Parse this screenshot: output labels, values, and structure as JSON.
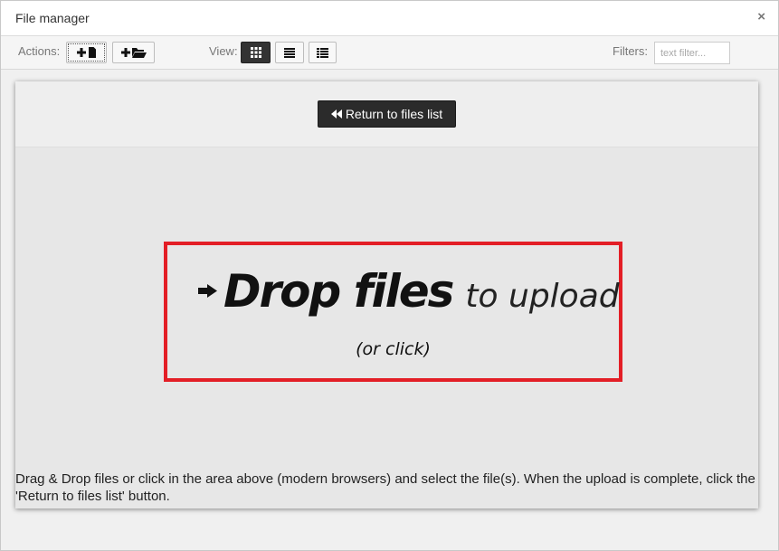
{
  "window": {
    "title": "File manager",
    "close_symbol": "×"
  },
  "toolbar": {
    "actions_label": "Actions:",
    "view_label": "View:",
    "filters_label": "Filters:",
    "filter_placeholder": "text filter...",
    "buttons": [
      {
        "name": "add-file-button",
        "icon": "plus-file-icon"
      },
      {
        "name": "add-folder-button",
        "icon": "plus-folder-icon"
      },
      {
        "name": "view-grid-button",
        "icon": "grid-icon",
        "active": true
      },
      {
        "name": "view-list-button",
        "icon": "list-icon"
      },
      {
        "name": "view-details-button",
        "icon": "details-icon"
      }
    ]
  },
  "upload": {
    "return_label": "Return to files list",
    "drop_strong": "Drop files",
    "drop_light": "to upload",
    "drop_sub": "(or click)",
    "help_text": "Drag & Drop files or click in the area above (modern browsers) and select the file(s). When the upload is complete, click the 'Return to files list' button."
  },
  "colors": {
    "accent_red": "#e31e26",
    "dark_button": "#2b2b2b"
  }
}
